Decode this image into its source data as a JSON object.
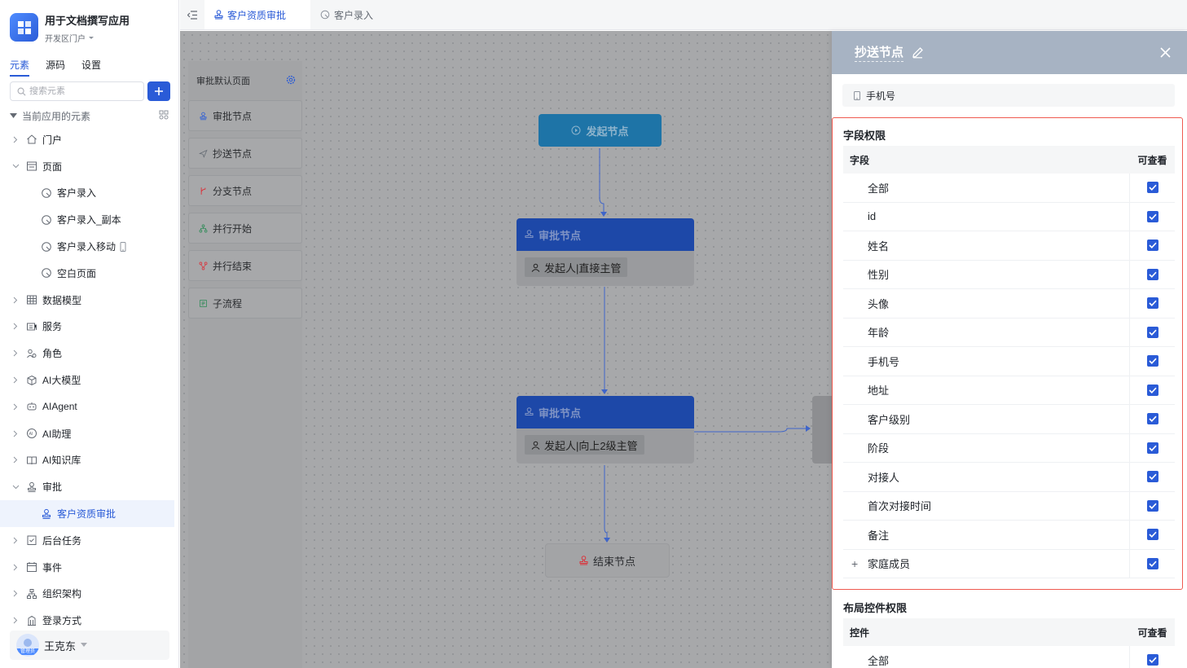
{
  "app": {
    "title": "用于文档撰写应用",
    "portal": "开发区门户"
  },
  "sidebar": {
    "tabs": [
      "元素",
      "源码",
      "设置"
    ],
    "search_placeholder": "搜索元素",
    "section_label": "当前应用的元素",
    "tree": [
      {
        "label": "门户",
        "icon": "home-icon",
        "level": 1,
        "chevron": "right"
      },
      {
        "label": "页面",
        "icon": "page-icon",
        "level": 1,
        "chevron": "down"
      },
      {
        "label": "客户录入",
        "icon": "form-page-icon",
        "level": 2
      },
      {
        "label": "客户录入_副本",
        "icon": "form-page-icon",
        "level": 2
      },
      {
        "label": "客户录入移动",
        "icon": "form-page-icon",
        "level": 2,
        "suffix_icon": "mobile-icon"
      },
      {
        "label": "空白页面",
        "icon": "form-page-icon",
        "level": 2
      },
      {
        "label": "数据模型",
        "icon": "table-icon",
        "level": 1,
        "chevron": "right"
      },
      {
        "label": "服务",
        "icon": "service-icon",
        "level": 1,
        "chevron": "right"
      },
      {
        "label": "角色",
        "icon": "role-icon",
        "level": 1,
        "chevron": "right"
      },
      {
        "label": "AI大模型",
        "icon": "cube-icon",
        "level": 1,
        "chevron": "right"
      },
      {
        "label": "AIAgent",
        "icon": "robot-icon",
        "level": 1,
        "chevron": "right"
      },
      {
        "label": "AI助理",
        "icon": "ai-icon",
        "level": 1,
        "chevron": "right"
      },
      {
        "label": "AI知识库",
        "icon": "book-icon",
        "level": 1,
        "chevron": "right"
      },
      {
        "label": "审批",
        "icon": "stamp-icon",
        "level": 1,
        "chevron": "down"
      },
      {
        "label": "客户资质审批",
        "icon": "stamp-icon",
        "level": 2,
        "selected": true
      },
      {
        "label": "后台任务",
        "icon": "task-icon",
        "level": 1,
        "chevron": "right"
      },
      {
        "label": "事件",
        "icon": "event-icon",
        "level": 1,
        "chevron": "right"
      },
      {
        "label": "组织架构",
        "icon": "org-icon",
        "level": 1,
        "chevron": "right"
      },
      {
        "label": "登录方式",
        "icon": "login-icon",
        "level": 1,
        "chevron": "right"
      }
    ],
    "user": {
      "name": "王克东",
      "role": "管理员"
    }
  },
  "topbar": {
    "tabs": [
      {
        "label": "客户资质审批",
        "icon": "stamp-icon",
        "active": true
      },
      {
        "label": "客户录入",
        "icon": "form-page-icon",
        "active": false
      }
    ]
  },
  "palette": {
    "title": "审批默认页面",
    "items": [
      {
        "label": "审批节点",
        "icon": "stamp-icon",
        "color": "#2a5bd7"
      },
      {
        "label": "抄送节点",
        "icon": "send-icon",
        "color": "#646a73"
      },
      {
        "label": "分支节点",
        "icon": "branch-icon",
        "color": "#d9363e"
      },
      {
        "label": "并行开始",
        "icon": "parallel-start-icon",
        "color": "#2e8b57"
      },
      {
        "label": "并行结束",
        "icon": "parallel-end-icon",
        "color": "#d9363e"
      },
      {
        "label": "子流程",
        "icon": "subflow-icon",
        "color": "#2e8b57"
      }
    ]
  },
  "flow": {
    "start": "发起节点",
    "approve1": {
      "title": "审批节点",
      "assignee": "发起人|直接主管"
    },
    "approve2": {
      "title": "审批节点",
      "assignee": "发起人|向上2级主管"
    },
    "end": "结束节点"
  },
  "panel": {
    "title": "抄送节点",
    "phone_field": "手机号",
    "field_section": {
      "title": "字段权限",
      "col_field": "字段",
      "col_view": "可查看",
      "rows": [
        {
          "label": "全部",
          "checked": true
        },
        {
          "label": "id",
          "checked": true
        },
        {
          "label": "姓名",
          "checked": true
        },
        {
          "label": "性别",
          "checked": true
        },
        {
          "label": "头像",
          "checked": true
        },
        {
          "label": "年龄",
          "checked": true
        },
        {
          "label": "手机号",
          "checked": true
        },
        {
          "label": "地址",
          "checked": true
        },
        {
          "label": "客户级别",
          "checked": true
        },
        {
          "label": "阶段",
          "checked": true
        },
        {
          "label": "对接人",
          "checked": true
        },
        {
          "label": "首次对接时间",
          "checked": true
        },
        {
          "label": "备注",
          "checked": true
        },
        {
          "label": "家庭成员",
          "checked": true,
          "expandable": true
        }
      ]
    },
    "layout_section": {
      "title": "布局控件权限",
      "col_field": "控件",
      "col_view": "可查看",
      "rows": [
        {
          "label": "全部",
          "checked": true
        }
      ]
    }
  },
  "colors": {
    "accent": "#2a5bd7",
    "highlight_border": "#ef5a4f"
  }
}
